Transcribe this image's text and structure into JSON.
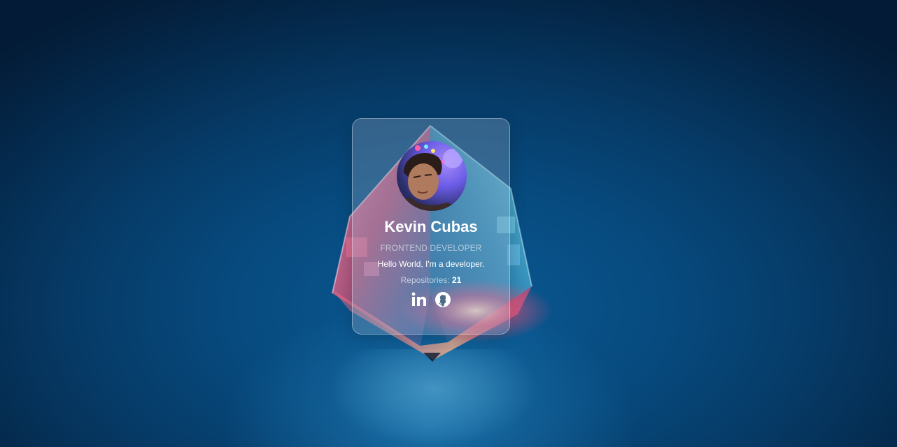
{
  "profile": {
    "name": "Kevin Cubas",
    "role": "FRONTEND DEVELOPER",
    "bio": "Hello World, I'm a developer.",
    "repos_label": "Repositories:",
    "repos_count": "21",
    "avatar_icon": "user-avatar"
  },
  "socials": [
    {
      "icon": "linkedin-icon",
      "label": "LinkedIn"
    },
    {
      "icon": "github-icon",
      "label": "GitHub"
    }
  ],
  "colors": {
    "background": "#074a7e",
    "card": "rgba(150,175,200,0.32)",
    "text": "#ffffff",
    "muted": "#dce4ee"
  }
}
